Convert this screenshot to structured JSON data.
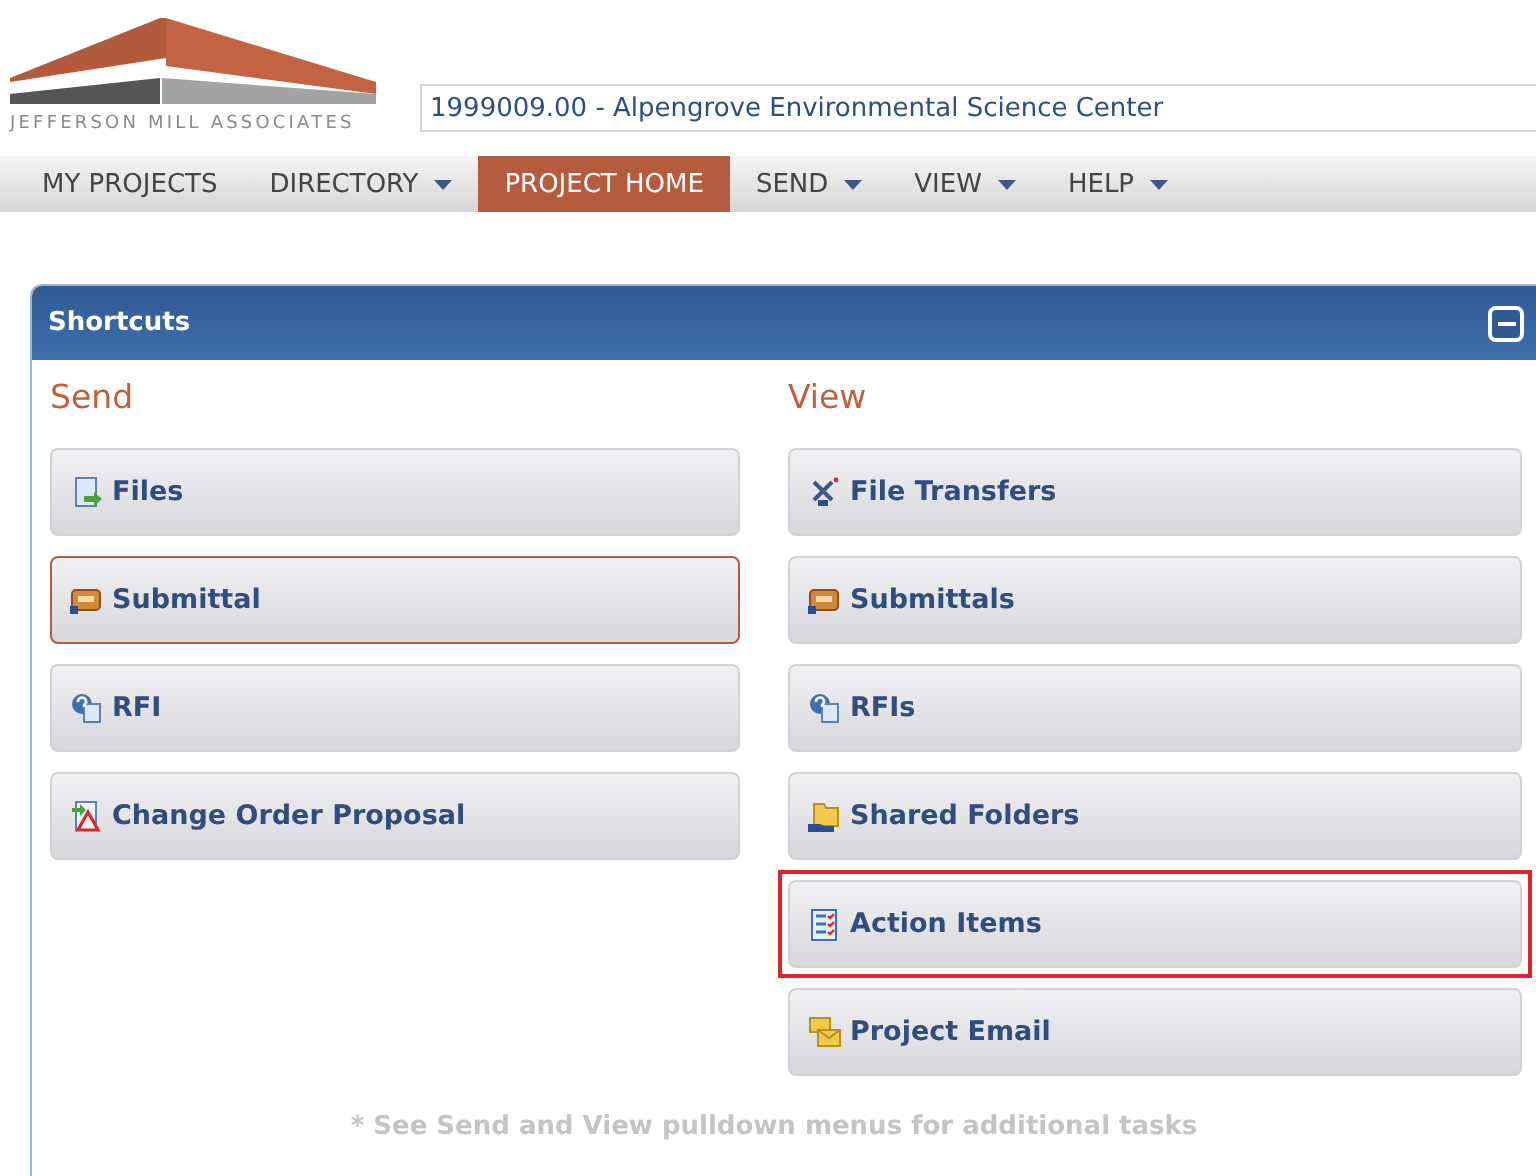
{
  "logo": {
    "text": "JEFFERSON MILL ASSOCIATES"
  },
  "project_field": {
    "value": "1999009.00 - Alpengrove Environmental Science Center"
  },
  "nav": [
    {
      "label": "MY PROJECTS",
      "selected": false,
      "dropdown": false
    },
    {
      "label": "DIRECTORY",
      "selected": false,
      "dropdown": true
    },
    {
      "label": "PROJECT HOME",
      "selected": true,
      "dropdown": false
    },
    {
      "label": "SEND",
      "selected": false,
      "dropdown": true
    },
    {
      "label": "VIEW",
      "selected": false,
      "dropdown": true
    },
    {
      "label": "HELP",
      "selected": false,
      "dropdown": true
    }
  ],
  "panel": {
    "title": "Shortcuts",
    "collapse_button": true,
    "columns": [
      {
        "heading": "Send",
        "buttons": [
          {
            "label": "Files",
            "kind": "file",
            "focused": false,
            "highlighted": false
          },
          {
            "label": "Submittal",
            "kind": "submittal",
            "focused": true,
            "highlighted": false
          },
          {
            "label": "RFI",
            "kind": "rfi",
            "focused": false,
            "highlighted": false
          },
          {
            "label": "Change Order Proposal",
            "kind": "change",
            "focused": false,
            "highlighted": false
          }
        ]
      },
      {
        "heading": "View",
        "buttons": [
          {
            "label": "File Transfers",
            "kind": "satellite",
            "focused": false,
            "highlighted": false
          },
          {
            "label": "Submittals",
            "kind": "submittal",
            "focused": false,
            "highlighted": false
          },
          {
            "label": "RFIs",
            "kind": "rfi",
            "focused": false,
            "highlighted": false
          },
          {
            "label": "Shared Folders",
            "kind": "folder",
            "focused": false,
            "highlighted": false
          },
          {
            "label": "Action Items",
            "kind": "checklist",
            "focused": false,
            "highlighted": true
          },
          {
            "label": "Project Email",
            "kind": "email",
            "focused": false,
            "highlighted": false
          }
        ]
      }
    ],
    "footnote": "* See Send and View pulldown menus for additional tasks"
  }
}
